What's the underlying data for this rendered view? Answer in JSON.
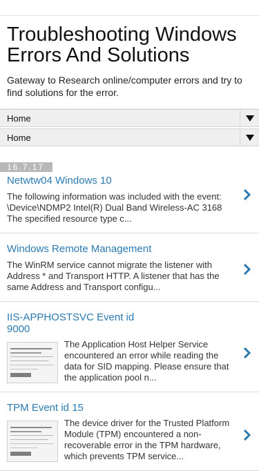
{
  "blog": {
    "title": "Troubleshooting Windows Errors And Solutions",
    "description": "Gateway to Research online/computer errors and try to find solutions for the error."
  },
  "nav": [
    {
      "label": "Home"
    },
    {
      "label": "Home"
    }
  ],
  "date_header": "16.7.17",
  "posts": [
    {
      "title": "Netwtw04 Windows 10",
      "snippet": "The following information was included with the event: \\Device\\NDMP2 Intel(R) Dual Band Wireless-AC 3168 The specified resource type c..."
    },
    {
      "title": "Windows Remote Management",
      "snippet": "The WinRM service cannot migrate the listener with Address * and Transport HTTP. A listener that has the same Address and Transport configu..."
    },
    {
      "title": "IIS-APPHOSTSVC Event id 9000",
      "snippet": "The Application Host Helper Service encountered an error while reading the data for SID mapping.  Please ensure that the application pool n..."
    },
    {
      "title": "TPM Event id 15",
      "snippet": "The device driver for the Trusted Platform Module (TPM) encountered a non-recoverable error in the TPM hardware, which prevents TPM service..."
    }
  ],
  "colors": {
    "link": "#2a7ab0",
    "date_bg": "#b8b8b8",
    "nav_bg": "#efefef"
  },
  "icons": {
    "nav_dropdown": "triangle-down-icon",
    "post_open": "chevron-right-icon"
  }
}
